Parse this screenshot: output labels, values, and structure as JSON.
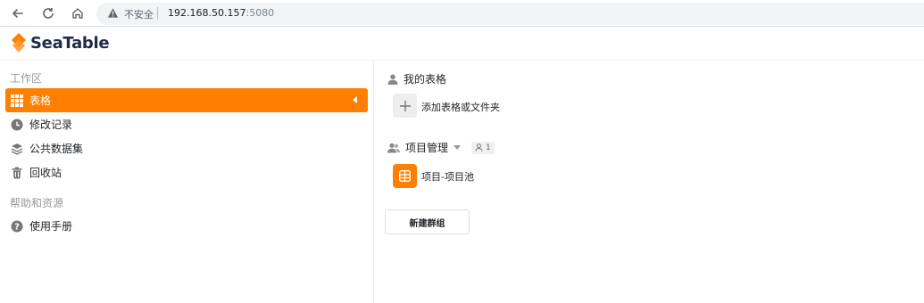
{
  "browser": {
    "security_label": "不安全",
    "url_host": "192.168.50.157",
    "url_port": ":5080"
  },
  "app": {
    "logo_text": "SeaTable",
    "brand_color": "#ff8000"
  },
  "sidebar": {
    "workspace_title": "工作区",
    "items": [
      {
        "label": "表格",
        "icon": "grid-icon",
        "active": true
      },
      {
        "label": "修改记录",
        "icon": "clock-icon",
        "active": false
      },
      {
        "label": "公共数据集",
        "icon": "layers-icon",
        "active": false
      },
      {
        "label": "回收站",
        "icon": "trash-icon",
        "active": false
      }
    ],
    "help_title": "帮助和资源",
    "help_items": [
      {
        "label": "使用手册",
        "icon": "question-icon"
      }
    ]
  },
  "main": {
    "my_tables_title": "我的表格",
    "add_label": "添加表格或文件夹",
    "group": {
      "name": "项目管理",
      "member_count": "1",
      "bases": [
        {
          "label": "项目-项目池"
        }
      ]
    },
    "new_group_label": "新建群组"
  }
}
